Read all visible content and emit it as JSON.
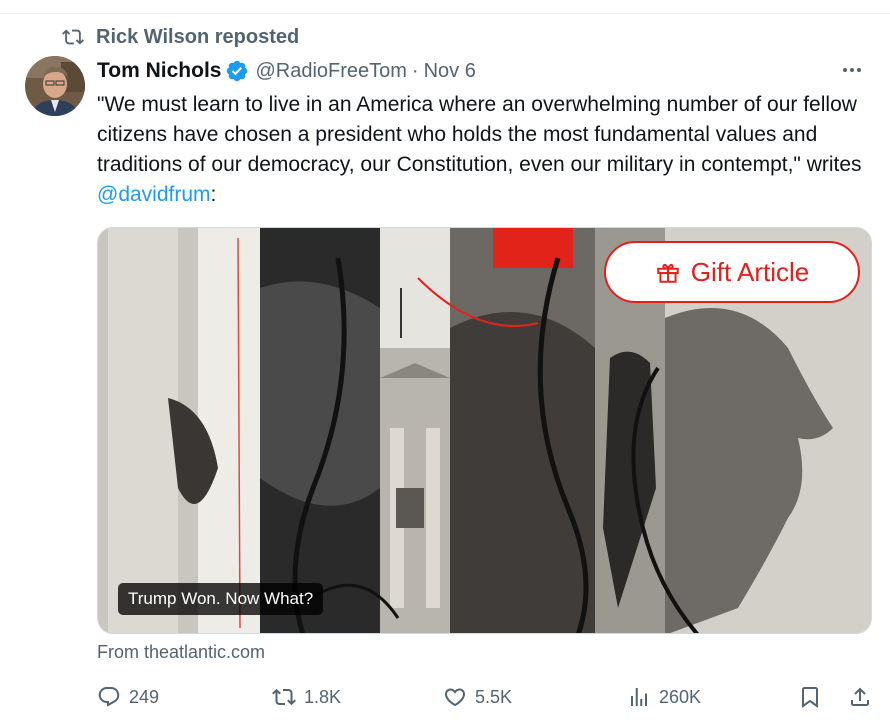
{
  "repost": {
    "label": "Rick Wilson reposted",
    "icon": "repost-icon"
  },
  "author": {
    "name": "Tom Nichols",
    "handle": "@RadioFreeTom",
    "separator": "·",
    "date": "Nov 6",
    "verified_icon": "verified-badge-icon",
    "verified_color": "#1d9bf0"
  },
  "tweet": {
    "text_before": "\"We must learn to live in an America where an overwhelming number of our fellow citizens have chosen a president who holds the most fundamental values and traditions of our democracy, our Constitution, even our military in contempt,\" writes ",
    "mention": "@davidfrum",
    "text_after": ":"
  },
  "card": {
    "gift_label": "Gift Article",
    "gift_icon": "gift-icon",
    "gift_color": "#e3201b",
    "title": "Trump Won. Now What?",
    "source": "From theatlantic.com",
    "image_alt": "Atlantic collage illustration"
  },
  "actions": {
    "reply_count": "249",
    "repost_count": "1.8K",
    "like_count": "5.5K",
    "views_count": "260K",
    "icons": [
      "reply-icon",
      "repost-icon",
      "like-icon",
      "views-icon",
      "bookmark-icon",
      "share-icon"
    ]
  },
  "colors": {
    "text": "#0f1419",
    "secondary": "#536471",
    "link": "#1d9bf0",
    "border": "#cfd9de"
  }
}
